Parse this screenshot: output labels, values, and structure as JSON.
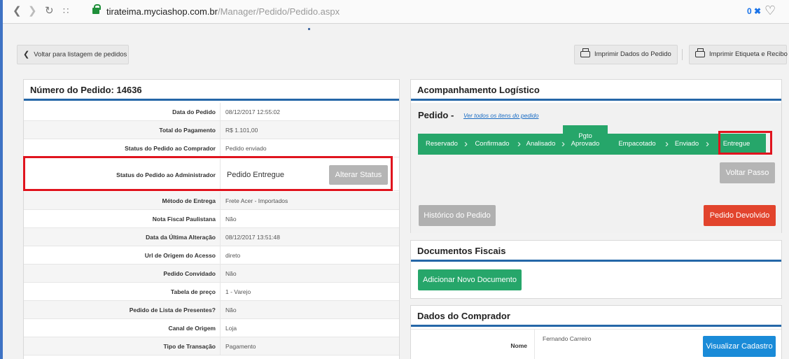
{
  "browser": {
    "url_domain": "tirateima.myciashop.com.br",
    "url_path": "/Manager/Pedido/Pedido.aspx",
    "extension_badge": "0"
  },
  "toolbar": {
    "back_label": "Voltar para listagem de pedidos",
    "print_data_label": "Imprimir Dados do Pedido",
    "print_label_label": "Imprimir Etiqueta e Recibo"
  },
  "order": {
    "title": "Número do Pedido: 14636",
    "rows": [
      {
        "label": "Data do Pedido",
        "value": "08/12/2017 12:55:02"
      },
      {
        "label": "Total do Pagamento",
        "value": "R$ 1.101,00"
      },
      {
        "label": "Status do Pedido ao Comprador",
        "value": "Pedido enviado"
      },
      {
        "label": "Status do Pedido ao Administrador",
        "value": "Pedido Entregue"
      },
      {
        "label": "Método de Entrega",
        "value": "Frete Acer - Importados"
      },
      {
        "label": "Nota Fiscal Paulistana",
        "value": "Não"
      },
      {
        "label": "Data da Última Alteração",
        "value": "08/12/2017 13:51:48"
      },
      {
        "label": "Url de Origem do Acesso",
        "value": "direto"
      },
      {
        "label": "Pedido Convidado",
        "value": "Não"
      },
      {
        "label": "Tabela de preço",
        "value": "1 - Varejo"
      },
      {
        "label": "Pedido de Lista de Presentes?",
        "value": "Não"
      },
      {
        "label": "Canal de Origem",
        "value": "Loja"
      },
      {
        "label": "Tipo de Transação",
        "value": "Pagamento"
      }
    ],
    "alter_status_label": "Alterar Status"
  },
  "logistics": {
    "title": "Acompanhamento Logístico",
    "pedido_label": "Pedido -",
    "see_all_link": "Ver todos os itens do pedido",
    "steps": [
      "Reservado",
      "Confirmado",
      "Analisado",
      "Pgto Aprovado",
      "Empacotado",
      "Enviado",
      "Entregue"
    ],
    "step_pgto_line1": "Pgto",
    "step_pgto_line2": "Aprovado",
    "back_step_label": "Voltar Passo",
    "history_label": "Histórico do Pedido",
    "returned_label": "Pedido Devolvido",
    "step_color": "#26a66a"
  },
  "fiscal": {
    "title": "Documentos Fiscais",
    "add_doc_label": "Adicionar Novo Documento"
  },
  "buyer": {
    "title": "Dados do Comprador",
    "name_label": "Nome",
    "name_value": "Fernando Carreiro",
    "view_label": "Visualizar Cadastro"
  },
  "colors": {
    "accent_blue": "#2567a8",
    "highlight_red": "#e0141e",
    "danger": "#e2442d",
    "primary": "#1a8bd8"
  }
}
